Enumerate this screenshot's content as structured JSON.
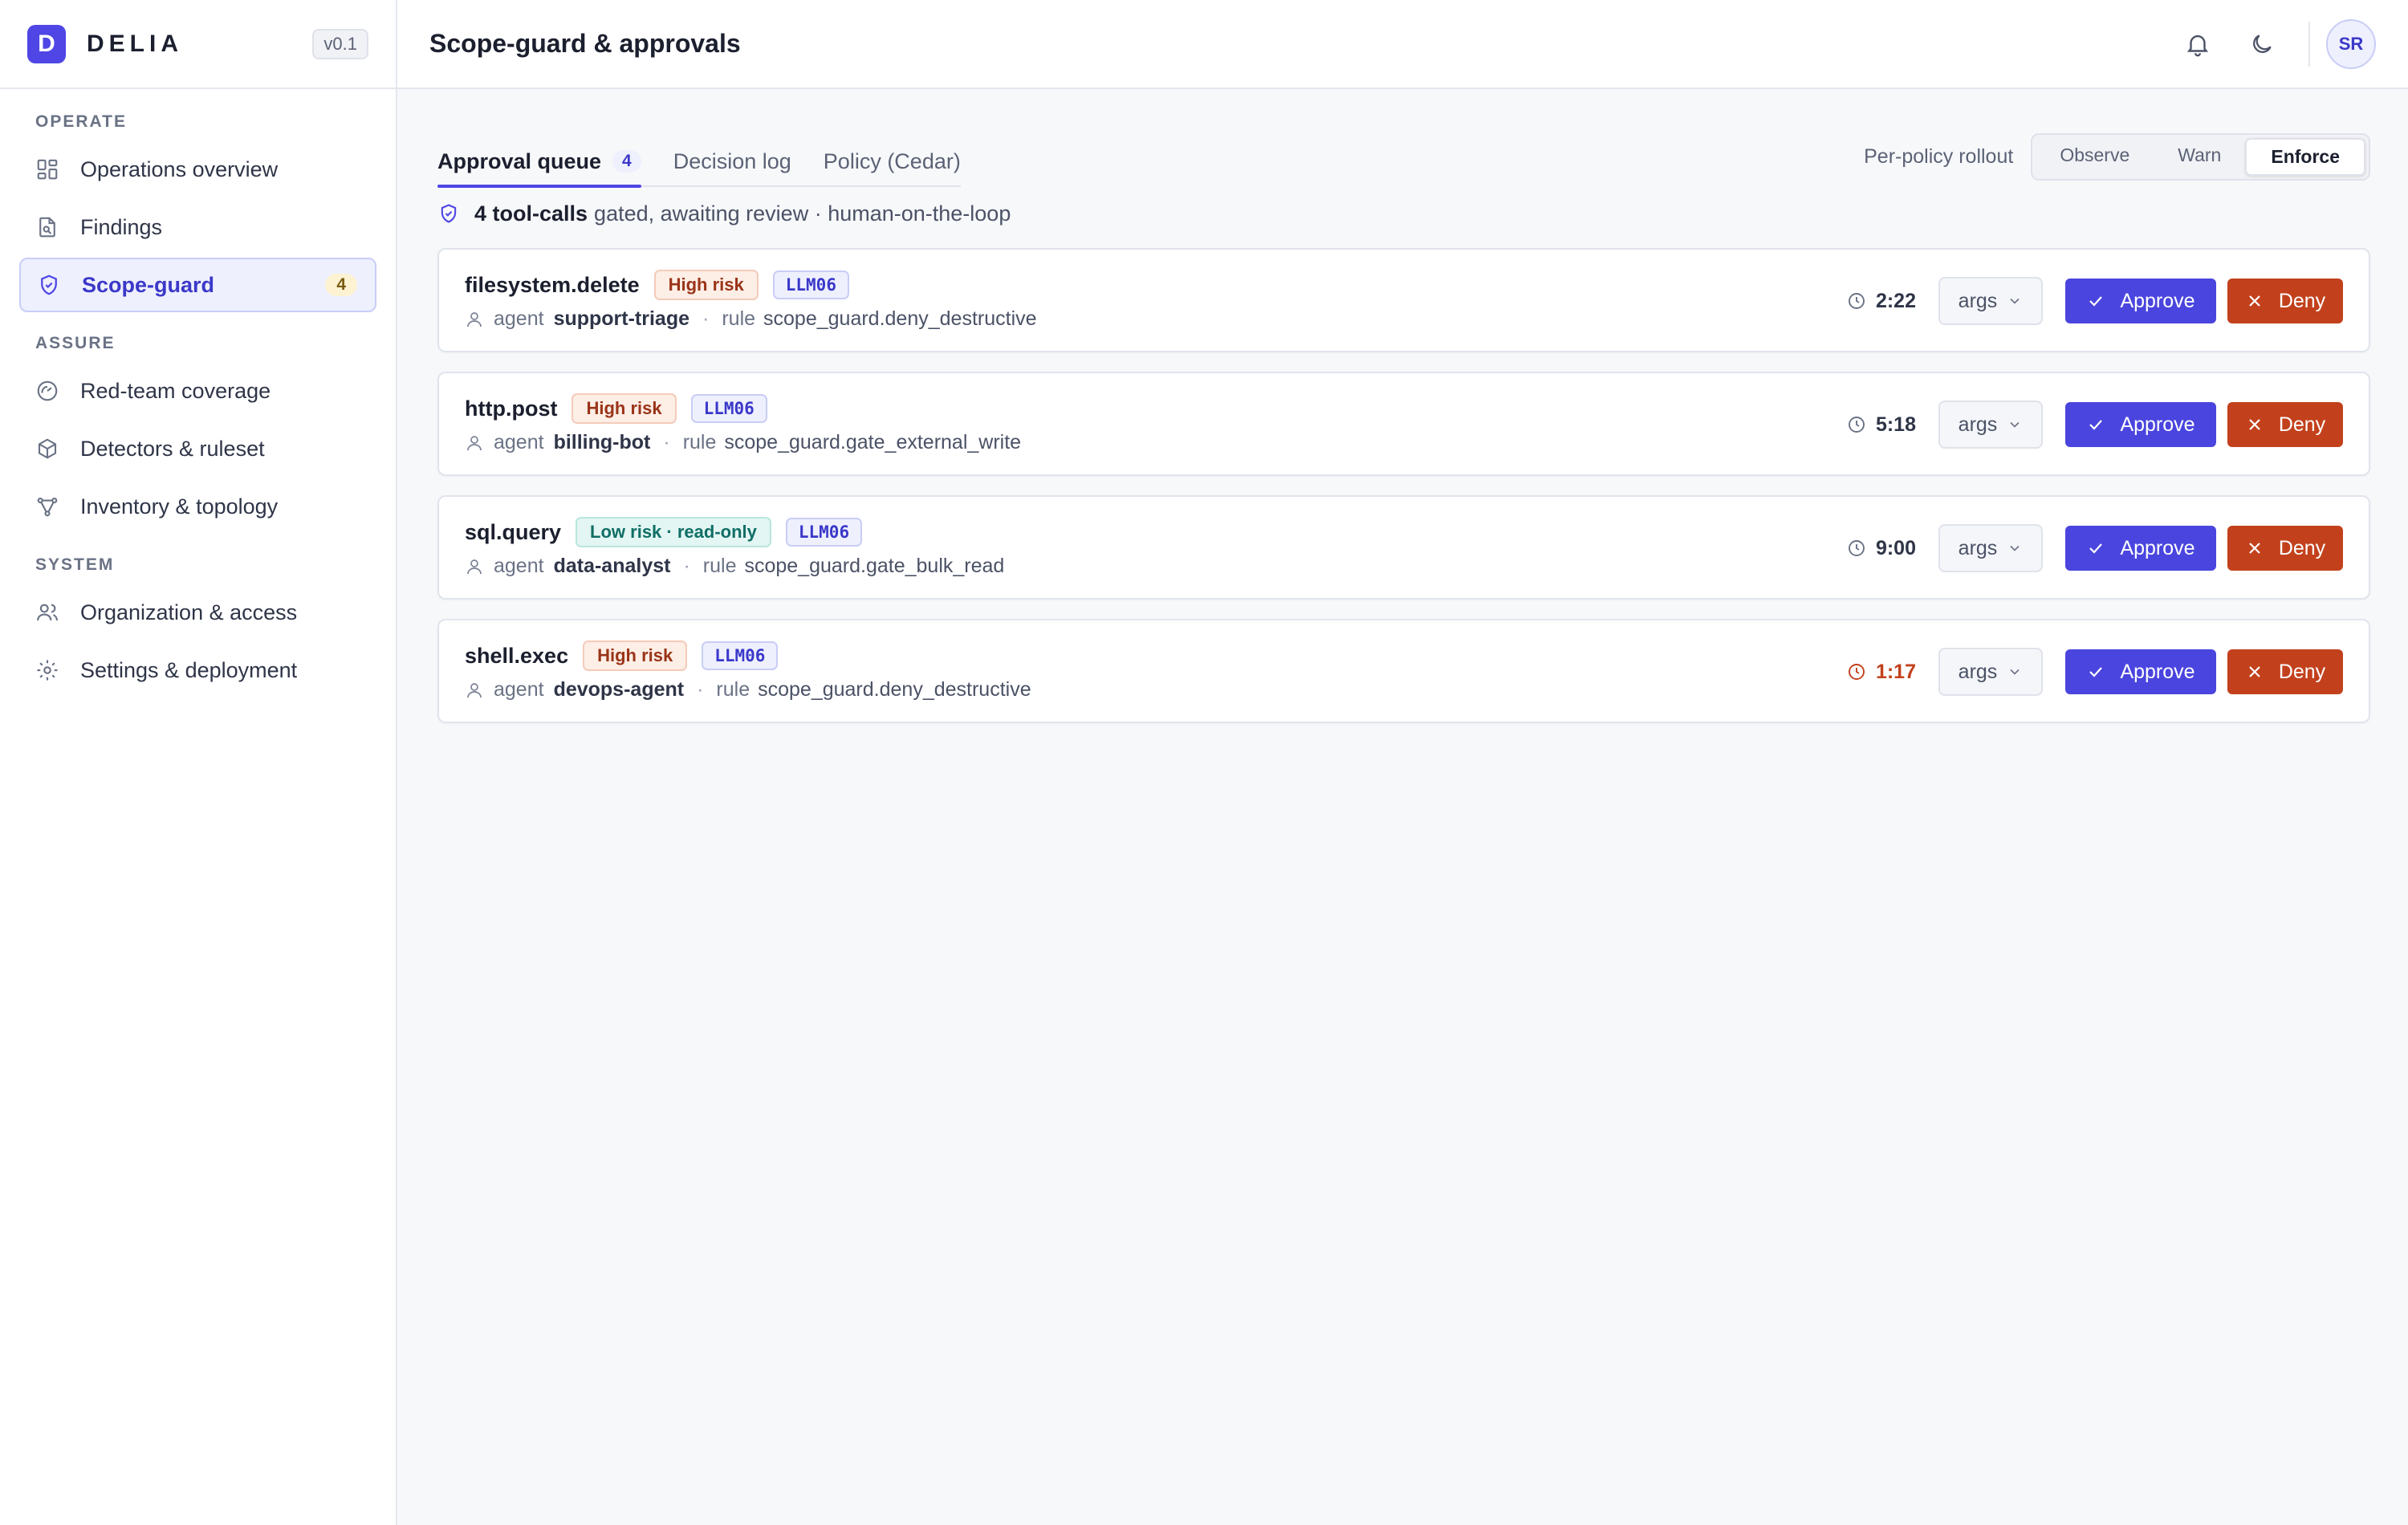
{
  "brand": {
    "logo_letter": "D",
    "name": "DELIA",
    "version": "v0.1"
  },
  "sidebar": {
    "sections": [
      {
        "label": "OPERATE"
      },
      {
        "label": "ASSURE"
      },
      {
        "label": "SYSTEM"
      }
    ],
    "items": [
      {
        "label": "Operations overview",
        "icon": "grid-icon"
      },
      {
        "label": "Findings",
        "icon": "document-search-icon"
      },
      {
        "label": "Scope-guard",
        "icon": "shield-check-icon",
        "badge": "4",
        "active": true
      },
      {
        "label": "Red-team coverage",
        "icon": "gauge-icon"
      },
      {
        "label": "Detectors & ruleset",
        "icon": "cube-icon"
      },
      {
        "label": "Inventory & topology",
        "icon": "topology-icon"
      },
      {
        "label": "Organization & access",
        "icon": "users-icon"
      },
      {
        "label": "Settings & deployment",
        "icon": "gear-icon"
      }
    ]
  },
  "header": {
    "title": "Scope-guard & approvals",
    "avatar_initials": "SR"
  },
  "tabs": [
    {
      "label": "Approval queue",
      "count": "4",
      "active": true
    },
    {
      "label": "Decision log"
    },
    {
      "label": "Policy (Cedar)"
    }
  ],
  "rollout": {
    "label": "Per-policy rollout",
    "options": [
      "Observe",
      "Warn",
      "Enforce"
    ],
    "selected": "Enforce"
  },
  "summary": {
    "strong": "4 tool-calls",
    "rest": "gated, awaiting review · human-on-the-loop"
  },
  "queue_labels": {
    "agent": "agent",
    "rule": "rule",
    "separator": "·",
    "args": "args",
    "approve": "Approve",
    "deny": "Deny"
  },
  "queue": [
    {
      "tool": "filesystem.delete",
      "risk": "High risk",
      "owasp": "LLM06",
      "agent": "support-triage",
      "rule": "scope_guard.deny_destructive",
      "timer": "2:22"
    },
    {
      "tool": "http.post",
      "risk": "High risk",
      "owasp": "LLM06",
      "agent": "billing-bot",
      "rule": "scope_guard.gate_external_write",
      "timer": "5:18"
    },
    {
      "tool": "sql.query",
      "risk": "Low risk · read-only",
      "owasp": "LLM06",
      "agent": "data-analyst",
      "rule": "scope_guard.gate_bulk_read",
      "timer": "9:00"
    },
    {
      "tool": "shell.exec",
      "risk": "High risk",
      "owasp": "LLM06",
      "agent": "devops-agent",
      "rule": "scope_guard.deny_destructive",
      "timer": "1:17"
    }
  ],
  "colors": {
    "accent": "#4f46e5",
    "approve": "#4a45de",
    "deny": "#c2411c",
    "high_risk": "#9a3418",
    "low_risk": "#0f6e66",
    "urgent_timer": "#c2411c"
  }
}
